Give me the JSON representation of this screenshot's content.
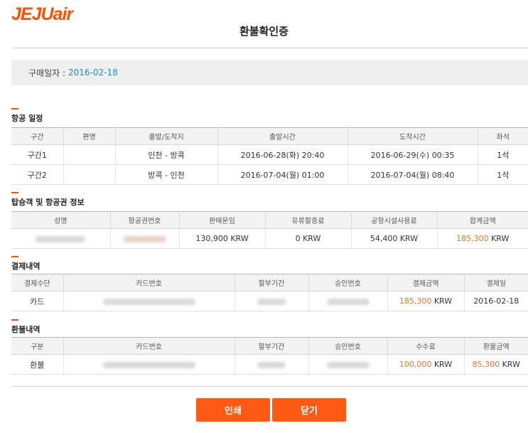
{
  "brand": {
    "logo_text": "JEJUair"
  },
  "title": "환불확인증",
  "purchase": {
    "label": "구매일자 :",
    "value": "2016-02-18"
  },
  "flight": {
    "section_title": "항공 일정",
    "headers": [
      "구간",
      "편명",
      "출발/도착지",
      "출발시간",
      "도착시간",
      "좌석"
    ],
    "rows": [
      {
        "segment": "구간1",
        "flight_no": "",
        "route": "인천 - 방콕",
        "depart": "2016-06-28(화) 20:40",
        "arrive": "2016-06-29(수) 00:35",
        "seat": "1석"
      },
      {
        "segment": "구간2",
        "flight_no": "",
        "route": "방콕 - 인천",
        "depart": "2016-07-04(월) 01:00",
        "arrive": "2016-07-04(월) 08:40",
        "seat": "1석"
      }
    ]
  },
  "passenger": {
    "section_title": "탑승객 및 항공권 정보",
    "headers": [
      "성명",
      "항공권번호",
      "판매운임",
      "유류할증료",
      "공항시설사용료",
      "합계금액"
    ],
    "row": {
      "fare_amount": "130,900",
      "fuel_amount": "0",
      "airport_amount": "54,400",
      "total_amount": "185,300",
      "currency": "KRW"
    }
  },
  "payment": {
    "section_title": "결제내역",
    "headers": [
      "결제수단",
      "카드번호",
      "할부기간",
      "승인번호",
      "결제금액",
      "결제일"
    ],
    "row": {
      "method": "카드",
      "amount": "185,300",
      "currency": "KRW",
      "date": "2016-02-18"
    }
  },
  "refund": {
    "section_title": "환불내역",
    "headers": [
      "구분",
      "카드번호",
      "할부기간",
      "승인번호",
      "수수료",
      "환불금액"
    ],
    "row": {
      "type": "환불",
      "fee_amount": "100,000",
      "refund_amount": "85,300",
      "currency": "KRW"
    }
  },
  "buttons": {
    "print": "인쇄",
    "close": "닫기"
  },
  "colors": {
    "accent": "#ff5a14",
    "amount": "#e87722",
    "date_link": "#1a8ed0"
  }
}
